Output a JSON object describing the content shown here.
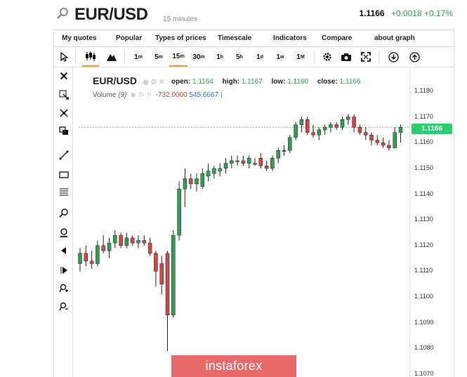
{
  "header": {
    "symbol": "EUR/USD",
    "timeframe_label": "15 minutes",
    "price": "1.1166",
    "change": "+0.0018",
    "change_pct": "+0.17%"
  },
  "menu": [
    "My quotes",
    "Popular",
    "Types of prices",
    "Timescale",
    "Indicators",
    "Compare",
    "about graph"
  ],
  "toolbar": {
    "timeframes": [
      {
        "num": "1",
        "unit": "m"
      },
      {
        "num": "5",
        "unit": "m"
      },
      {
        "num": "15",
        "unit": "m"
      },
      {
        "num": "30",
        "unit": "m"
      },
      {
        "num": "1",
        "unit": "h"
      },
      {
        "num": "5",
        "unit": "h"
      },
      {
        "num": "1",
        "unit": "d"
      },
      {
        "num": "1",
        "unit": "w"
      },
      {
        "num": "1",
        "unit": "M"
      }
    ],
    "active_timeframe": "15m",
    "icons": [
      "cursor-icon",
      "candles-icon",
      "area-chart-icon",
      "gear-icon",
      "camera-icon",
      "fullscreen-icon",
      "download-icon",
      "upload-icon"
    ]
  },
  "left_tools": [
    "close-icon",
    "cursor-cross-icon",
    "magnet-icon",
    "clone-icon",
    "line-tool-icon",
    "rectangle-tool-icon",
    "fib-levels-icon",
    "zoom-in-icon",
    "zoom-out-icon",
    "arrow-left-icon",
    "arrow-right-icon",
    "zoom-plus-icon",
    "zoom-minus-icon"
  ],
  "legend": {
    "symbol": "EUR/USD",
    "open_label": "open:",
    "open": "1.1164",
    "high_label": "high:",
    "high": "1.1167",
    "low_label": "low:",
    "low": "1.1160",
    "close_label": "close:",
    "close": "1.1166",
    "volume_label": "Volume",
    "volume_period": "(9)",
    "volume_neg": "-732.0000",
    "volume_pos": "545.6667"
  },
  "watermark": "instaforex",
  "colors": {
    "up": "#2e9e4f",
    "down": "#d64545",
    "tag": "#2ecc71",
    "accent": "#f0a032"
  },
  "chart_data": {
    "type": "candlestick",
    "ylim": [
      1.1065,
      1.119
    ],
    "y_ticks": [
      "1.1180",
      "1.1170",
      "1.1160",
      "1.1150",
      "1.1140",
      "1.1130",
      "1.1120",
      "1.1110",
      "1.1100",
      "1.1090",
      "1.1080",
      "1.1070"
    ],
    "last_price": "1.1166",
    "candles": [
      {
        "o": 1.1113,
        "h": 1.1119,
        "l": 1.111,
        "c": 1.1117
      },
      {
        "o": 1.1117,
        "h": 1.112,
        "l": 1.1112,
        "c": 1.1114
      },
      {
        "o": 1.1114,
        "h": 1.1118,
        "l": 1.1111,
        "c": 1.1113
      },
      {
        "o": 1.1113,
        "h": 1.1122,
        "l": 1.1112,
        "c": 1.112
      },
      {
        "o": 1.112,
        "h": 1.1124,
        "l": 1.1117,
        "c": 1.1118
      },
      {
        "o": 1.1118,
        "h": 1.1123,
        "l": 1.1115,
        "c": 1.1121
      },
      {
        "o": 1.1121,
        "h": 1.1126,
        "l": 1.1119,
        "c": 1.1124
      },
      {
        "o": 1.1124,
        "h": 1.1125,
        "l": 1.1119,
        "c": 1.112
      },
      {
        "o": 1.112,
        "h": 1.1125,
        "l": 1.1119,
        "c": 1.1123
      },
      {
        "o": 1.1123,
        "h": 1.1124,
        "l": 1.112,
        "c": 1.1121
      },
      {
        "o": 1.1121,
        "h": 1.1124,
        "l": 1.1119,
        "c": 1.1122
      },
      {
        "o": 1.1122,
        "h": 1.1124,
        "l": 1.112,
        "c": 1.1121
      },
      {
        "o": 1.1121,
        "h": 1.1123,
        "l": 1.1116,
        "c": 1.1117
      },
      {
        "o": 1.1117,
        "h": 1.1118,
        "l": 1.1104,
        "c": 1.111
      },
      {
        "o": 1.1113,
        "h": 1.1116,
        "l": 1.1101,
        "c": 1.1105
      },
      {
        "o": 1.1117,
        "h": 1.1118,
        "l": 1.1079,
        "c": 1.1093
      },
      {
        "o": 1.1093,
        "h": 1.1126,
        "l": 1.1092,
        "c": 1.1124
      },
      {
        "o": 1.1124,
        "h": 1.1145,
        "l": 1.1122,
        "c": 1.1142
      },
      {
        "o": 1.1142,
        "h": 1.115,
        "l": 1.1135,
        "c": 1.1146
      },
      {
        "o": 1.1146,
        "h": 1.1148,
        "l": 1.1142,
        "c": 1.1144
      },
      {
        "o": 1.1144,
        "h": 1.1148,
        "l": 1.1141,
        "c": 1.1146
      },
      {
        "o": 1.1143,
        "h": 1.115,
        "l": 1.1142,
        "c": 1.1148
      },
      {
        "o": 1.1147,
        "h": 1.1152,
        "l": 1.1145,
        "c": 1.1149
      },
      {
        "o": 1.1148,
        "h": 1.1151,
        "l": 1.1146,
        "c": 1.115
      },
      {
        "o": 1.1149,
        "h": 1.1152,
        "l": 1.1147,
        "c": 1.115
      },
      {
        "o": 1.115,
        "h": 1.1154,
        "l": 1.1148,
        "c": 1.1152
      },
      {
        "o": 1.1152,
        "h": 1.1155,
        "l": 1.115,
        "c": 1.1153
      },
      {
        "o": 1.1153,
        "h": 1.1155,
        "l": 1.1151,
        "c": 1.1153
      },
      {
        "o": 1.1153,
        "h": 1.1155,
        "l": 1.1151,
        "c": 1.1152
      },
      {
        "o": 1.1152,
        "h": 1.1155,
        "l": 1.115,
        "c": 1.1154
      },
      {
        "o": 1.1152,
        "h": 1.1154,
        "l": 1.1151,
        "c": 1.1152
      },
      {
        "o": 1.1154,
        "h": 1.1156,
        "l": 1.115,
        "c": 1.1151
      },
      {
        "o": 1.1151,
        "h": 1.1153,
        "l": 1.1149,
        "c": 1.115
      },
      {
        "o": 1.115,
        "h": 1.1155,
        "l": 1.1149,
        "c": 1.1154
      },
      {
        "o": 1.1154,
        "h": 1.1158,
        "l": 1.1152,
        "c": 1.1157
      },
      {
        "o": 1.1157,
        "h": 1.1159,
        "l": 1.1155,
        "c": 1.1157
      },
      {
        "o": 1.1157,
        "h": 1.1163,
        "l": 1.1156,
        "c": 1.1162
      },
      {
        "o": 1.1162,
        "h": 1.1168,
        "l": 1.1161,
        "c": 1.1167
      },
      {
        "o": 1.1167,
        "h": 1.117,
        "l": 1.1164,
        "c": 1.1169
      },
      {
        "o": 1.1169,
        "h": 1.117,
        "l": 1.1163,
        "c": 1.1164
      },
      {
        "o": 1.1164,
        "h": 1.1167,
        "l": 1.1162,
        "c": 1.1163
      },
      {
        "o": 1.1163,
        "h": 1.1166,
        "l": 1.1161,
        "c": 1.1165
      },
      {
        "o": 1.1165,
        "h": 1.1167,
        "l": 1.1163,
        "c": 1.1166
      },
      {
        "o": 1.1166,
        "h": 1.1168,
        "l": 1.1164,
        "c": 1.1167
      },
      {
        "o": 1.1167,
        "h": 1.1168,
        "l": 1.1165,
        "c": 1.1166
      },
      {
        "o": 1.1166,
        "h": 1.117,
        "l": 1.1165,
        "c": 1.1169
      },
      {
        "o": 1.1169,
        "h": 1.1171,
        "l": 1.1167,
        "c": 1.117
      },
      {
        "o": 1.117,
        "h": 1.1171,
        "l": 1.1164,
        "c": 1.1166
      },
      {
        "o": 1.1166,
        "h": 1.1167,
        "l": 1.1163,
        "c": 1.1164
      },
      {
        "o": 1.1164,
        "h": 1.1166,
        "l": 1.1161,
        "c": 1.1163
      },
      {
        "o": 1.1163,
        "h": 1.1164,
        "l": 1.1159,
        "c": 1.1161
      },
      {
        "o": 1.1161,
        "h": 1.1163,
        "l": 1.1159,
        "c": 1.116
      },
      {
        "o": 1.116,
        "h": 1.1162,
        "l": 1.1158,
        "c": 1.1159
      },
      {
        "o": 1.1159,
        "h": 1.1161,
        "l": 1.1157,
        "c": 1.1158
      },
      {
        "o": 1.1158,
        "h": 1.1166,
        "l": 1.1158,
        "c": 1.1164
      },
      {
        "o": 1.1164,
        "h": 1.1167,
        "l": 1.116,
        "c": 1.1166
      }
    ]
  }
}
